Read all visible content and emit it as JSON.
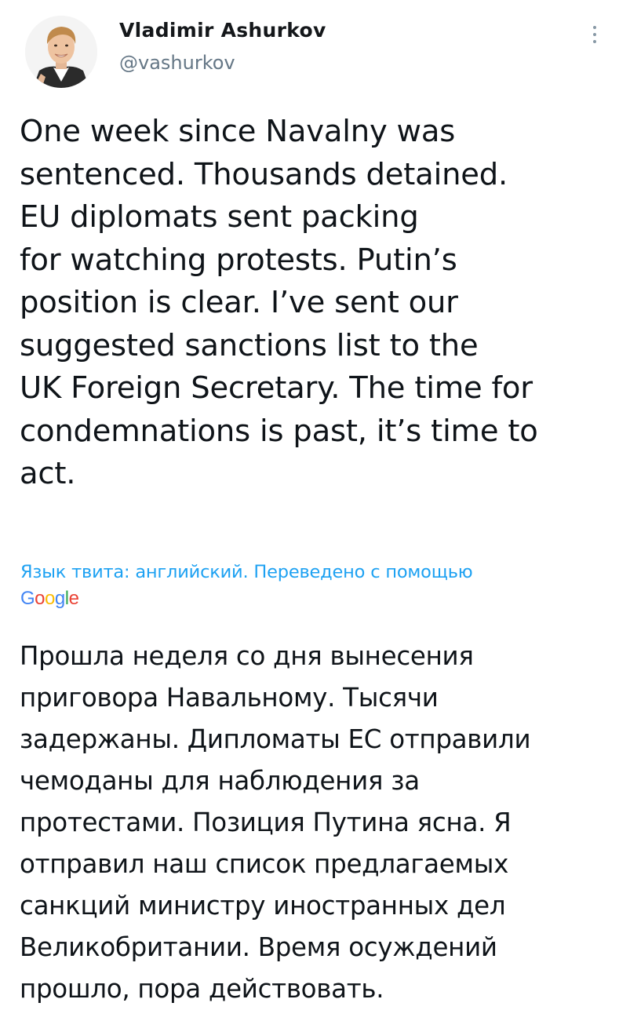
{
  "author": {
    "display_name": "Vladimir Ashurkov",
    "handle": "@vashurkov",
    "avatar_icon": "user-avatar-photo"
  },
  "menu": {
    "icon": "vertical-ellipsis-icon"
  },
  "tweet": {
    "text": "One week since Navalny was\nsentenced. Thousands detained.\nEU diplomats sent packing\nfor watching protests. Putin’s\nposition is clear. I’ve sent our\nsuggested sanctions list to the\nUK Foreign Secretary. The time for\ncondemnations is past, it’s time to\nact."
  },
  "translation": {
    "note": "Язык твита: английский. Переведено с помощью",
    "provider_letters": [
      "G",
      "o",
      "o",
      "g",
      "l",
      "e"
    ],
    "provider_colors": [
      "#4285f4",
      "#ea4335",
      "#fbbc05",
      "#4285f4",
      "#34a853",
      "#ea4335"
    ],
    "text": "Прошла неделя со дня вынесения\nприговора Навальному. Тысячи\nзадержаны. Дипломаты ЕС отправили\nчемоданы для наблюдения за\nпротестами. Позиция Путина ясна. Я\nотправил наш список предлагаемых\nсанкций министру иностранных дел\nВеликобритании. Время осуждений\nпрошло, пора действовать."
  },
  "colors": {
    "link": "#1da1f2",
    "text": "#0f1419",
    "secondary": "#657786"
  }
}
